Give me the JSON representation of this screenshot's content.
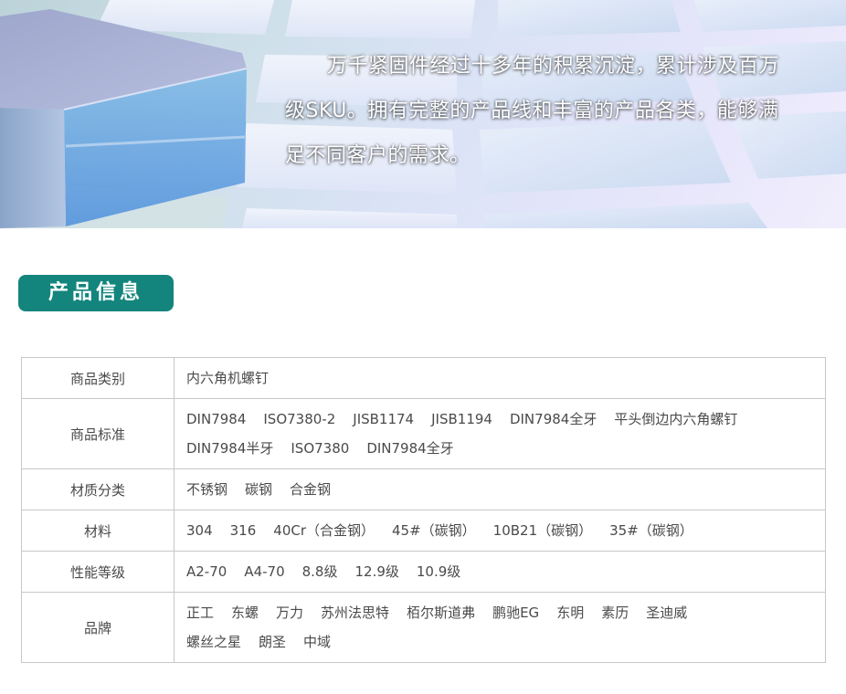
{
  "banner": {
    "lines": [
      "万千紧固件经过十多年的积累沉淀，累计涉及百万",
      "级SKU。拥有完整的产品线和丰富的产品各类，能够满",
      "足不同客户的需求。"
    ]
  },
  "section": {
    "title": "产品信息"
  },
  "table": {
    "rows": [
      {
        "label": "商品类别",
        "lines": [
          [
            "内六角机螺钉"
          ]
        ]
      },
      {
        "label": "商品标准",
        "lines": [
          [
            "DIN7984",
            "ISO7380-2",
            "JISB1174",
            "JISB1194",
            "DIN7984全牙",
            "平头倒边内六角螺钉"
          ],
          [
            "DIN7984半牙",
            "ISO7380",
            "DIN7984全牙"
          ]
        ]
      },
      {
        "label": "材质分类",
        "lines": [
          [
            "不锈钢",
            "碳钢",
            "合金钢"
          ]
        ]
      },
      {
        "label": "材料",
        "lines": [
          [
            "304",
            "316",
            "40Cr（合金钢）",
            "45#（碳钢）",
            "10B21（碳钢）",
            "35#（碳钢）"
          ]
        ]
      },
      {
        "label": "性能等级",
        "lines": [
          [
            "A2-70",
            "A4-70",
            "8.8级",
            "12.9级",
            "10.9级"
          ]
        ]
      },
      {
        "label": "品牌",
        "lines": [
          [
            "正工",
            "东螺",
            "万力",
            "苏州法思特",
            "栢尔斯道弗",
            "鹏驰EG",
            "东明",
            "素历",
            "圣迪威"
          ],
          [
            "螺丝之星",
            "朗圣",
            "中域"
          ]
        ]
      }
    ]
  }
}
